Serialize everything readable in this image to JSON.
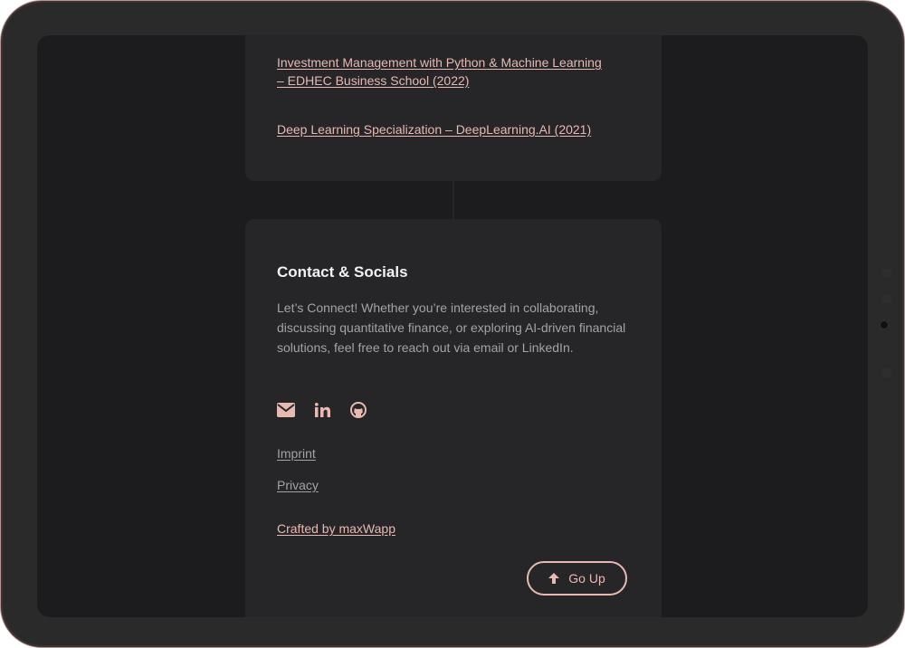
{
  "education": {
    "links": [
      "Investment Management with Python & Machine Learning – EDHEC Business School (2022)",
      "Deep Learning Specialization – DeepLearning.AI (2021)"
    ]
  },
  "contact": {
    "title": "Contact & Socials",
    "text": "Let’s Connect! Whether you’re interested in collaborating, discussing quantitative finance, or exploring AI-driven financial solutions, feel free to reach out via email or LinkedIn.",
    "icons": [
      "email-icon",
      "linkedin-icon",
      "github-icon"
    ]
  },
  "footer": {
    "imprint": "Imprint",
    "privacy": "Privacy",
    "crafted": "Crafted by maxWapp",
    "go_up": "Go Up"
  },
  "colors": {
    "accent": "#e8b9b1",
    "background": "#1c1c1e",
    "card": "#262628",
    "muted_text": "#a3a3a7"
  }
}
